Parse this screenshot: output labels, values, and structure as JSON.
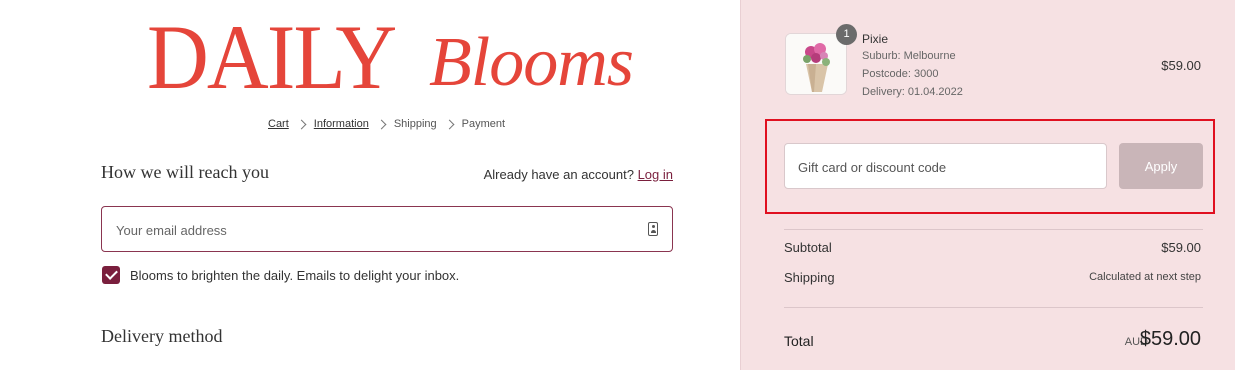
{
  "brand": {
    "logo_main": "DAILY",
    "logo_script": "Blooms"
  },
  "breadcrumb": [
    {
      "label": "Cart"
    },
    {
      "label": "Information"
    },
    {
      "label": "Shipping"
    },
    {
      "label": "Payment"
    }
  ],
  "contact": {
    "title": "How we will reach you",
    "account_prompt": "Already have an account?",
    "login_label": "Log in",
    "email_placeholder": "Your email address",
    "newsletter_label": "Blooms to brighten the daily. Emails to delight your inbox."
  },
  "delivery": {
    "title": "Delivery method"
  },
  "order": {
    "item": {
      "quantity": "1",
      "name": "Pixie",
      "suburb": "Suburb: Melbourne",
      "postcode": "Postcode: 3000",
      "delivery_date": "Delivery: 01.04.2022",
      "price": "$59.00"
    },
    "discount_placeholder": "Gift card or discount code",
    "apply_label": "Apply",
    "subtotal_label": "Subtotal",
    "subtotal_value": "$59.00",
    "shipping_label": "Shipping",
    "shipping_value": "Calculated at next step",
    "total_label": "Total",
    "currency": "AUD",
    "total_value": "$59.00"
  },
  "colors": {
    "brand_red": "#e5453a",
    "accent_maroon": "#7a1f3d",
    "summary_bg": "#f6e1e3",
    "highlight_red": "#e01020"
  }
}
